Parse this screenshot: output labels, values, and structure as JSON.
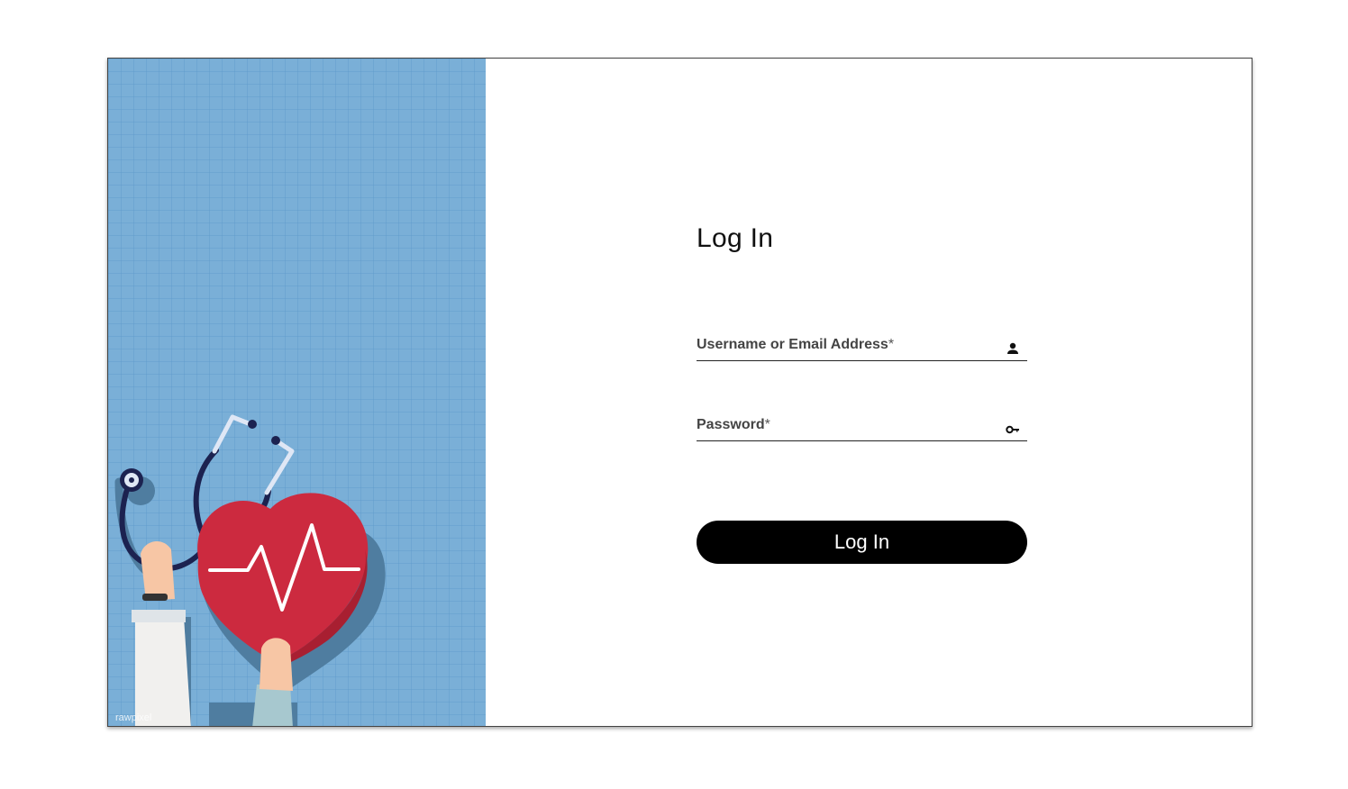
{
  "illustration": {
    "watermark": "rawpixel",
    "background_color": "#7aafd7",
    "heart_color": "#cc2a3f"
  },
  "form": {
    "title": "Log In",
    "username": {
      "label": "Username or Email Address",
      "required_mark": "*",
      "value": "",
      "icon": "person-icon"
    },
    "password": {
      "label": "Password",
      "required_mark": "*",
      "value": "",
      "icon": "key-icon"
    },
    "submit_label": "Log In"
  }
}
